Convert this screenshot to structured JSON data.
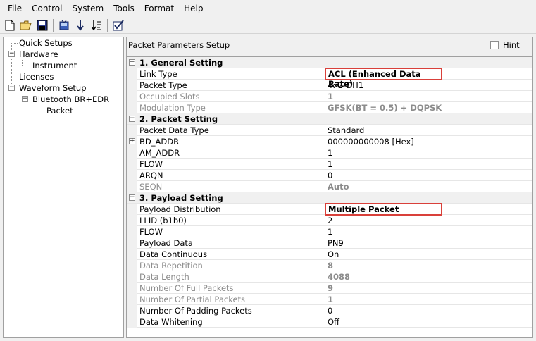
{
  "menu": [
    "File",
    "Control",
    "System",
    "Tools",
    "Format",
    "Help"
  ],
  "toolbar": {
    "icons": [
      "new-file-icon",
      "open-folder-icon",
      "save-icon",
      "instrument-icon",
      "download-icon",
      "sort-icon",
      "validate-check-icon"
    ]
  },
  "tree": {
    "quick_setups": "Quick Setups",
    "hardware": "Hardware",
    "instrument": "Instrument",
    "licenses": "Licenses",
    "waveform_setup": "Waveform Setup",
    "bluetooth": "Bluetooth BR+EDR",
    "packet": "Packet"
  },
  "panel": {
    "title": "Packet Parameters Setup",
    "hint": "Hint"
  },
  "sections": {
    "general": "1. General Setting",
    "packet": "2. Packet Setting",
    "payload": "3. Payload Setting"
  },
  "general": {
    "link_type": {
      "name": "Link Type",
      "value": "ACL (Enhanced Data Rate)"
    },
    "packet_type": {
      "name": "Packet Type",
      "value": "4: 2-DH1"
    },
    "occupied_slots": {
      "name": "Occupied Slots",
      "value": "1"
    },
    "modulation_type": {
      "name": "Modulation Type",
      "value": "GFSK(BT = 0.5) + DQPSK"
    }
  },
  "packet": {
    "packet_data_type": {
      "name": "Packet Data Type",
      "value": "Standard"
    },
    "bd_addr": {
      "name": "BD_ADDR",
      "value": "000000000008 [Hex]"
    },
    "am_addr": {
      "name": "AM_ADDR",
      "value": "1"
    },
    "flow": {
      "name": "FLOW",
      "value": "1"
    },
    "arqn": {
      "name": "ARQN",
      "value": "0"
    },
    "seqn": {
      "name": "SEQN",
      "value": "Auto"
    }
  },
  "payload": {
    "payload_distribution": {
      "name": "Payload Distribution",
      "value": "Multiple Packet"
    },
    "llid": {
      "name": "LLID (b1b0)",
      "value": "2"
    },
    "flow": {
      "name": "FLOW",
      "value": "1"
    },
    "payload_data": {
      "name": "Payload Data",
      "value": "PN9"
    },
    "data_continuous": {
      "name": "Data Continuous",
      "value": "On"
    },
    "data_repetition": {
      "name": "Data Repetition",
      "value": "8"
    },
    "data_length": {
      "name": "Data Length",
      "value": "4088"
    },
    "full_packets": {
      "name": "Number Of Full Packets",
      "value": "9"
    },
    "partial_packets": {
      "name": "Number Of Partial Packets",
      "value": "1"
    },
    "padding_packets": {
      "name": "Number Of Padding Packets",
      "value": "0"
    },
    "data_whitening": {
      "name": "Data Whitening",
      "value": "Off"
    }
  },
  "colors": {
    "highlight": "#d9403a",
    "disabled_text": "#8c8c8c",
    "section_bg": "#f0f0f0"
  }
}
